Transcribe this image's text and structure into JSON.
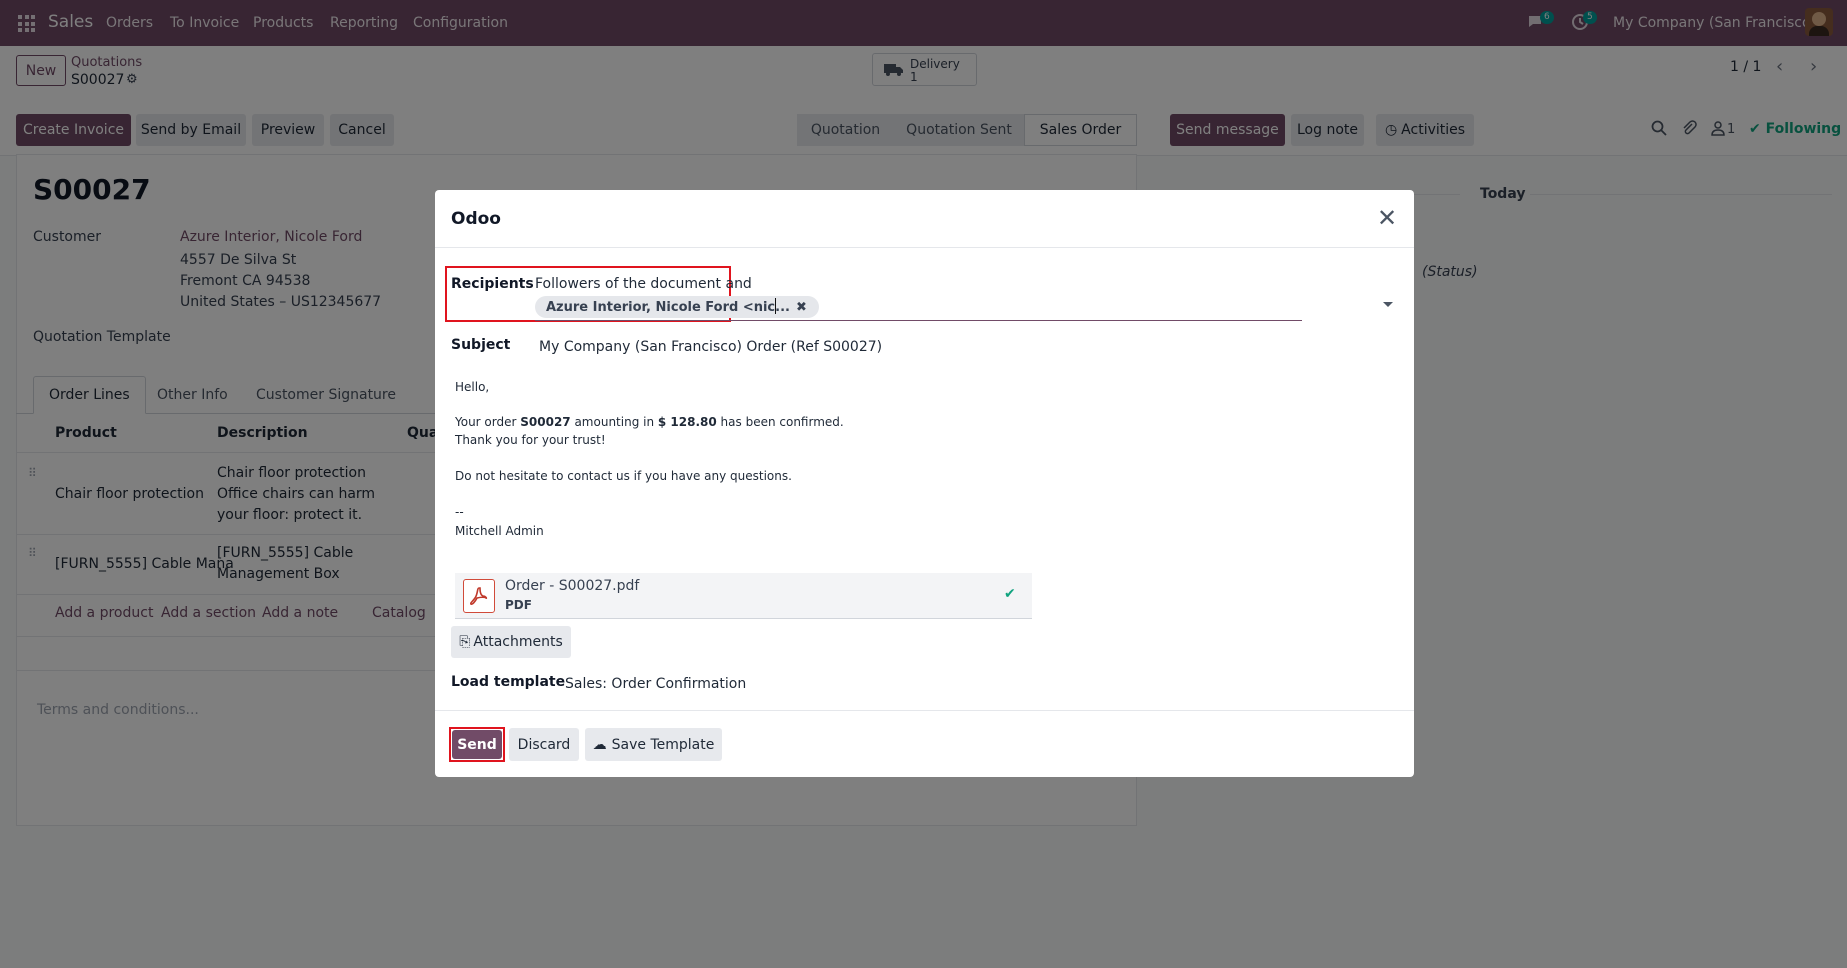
{
  "navbar": {
    "app": "Sales",
    "menu": [
      "Orders",
      "To Invoice",
      "Products",
      "Reporting",
      "Configuration"
    ],
    "messages_badge": "6",
    "activities_badge": "5",
    "company": "My Company (San Francisco)"
  },
  "control_panel": {
    "new_label": "New",
    "breadcrumb_parent": "Quotations",
    "breadcrumb_current": "S00027",
    "delivery_label": "Delivery",
    "delivery_count": "1",
    "pager": "1 / 1"
  },
  "actions": {
    "create_invoice": "Create Invoice",
    "send_by_email": "Send by Email",
    "preview": "Preview",
    "cancel": "Cancel"
  },
  "statusbar": [
    "Quotation",
    "Quotation Sent",
    "Sales Order"
  ],
  "chatter": {
    "send_message": "Send message",
    "log_note": "Log note",
    "activities": "Activities",
    "followers_count": "1",
    "following": "Following",
    "today": "Today",
    "status": "(Status)"
  },
  "form": {
    "name": "S00027",
    "customer_label": "Customer",
    "customer_name": "Azure Interior, Nicole Ford",
    "address": [
      "4557 De Silva St",
      "Fremont CA 94538",
      "United States – US12345677"
    ],
    "template_label": "Quotation Template",
    "tabs": [
      "Order Lines",
      "Other Info",
      "Customer Signature"
    ],
    "columns": [
      "Product",
      "Description",
      "Qua"
    ],
    "lines": [
      {
        "product": "Chair floor protection",
        "description": [
          "Chair floor protection",
          "Office chairs can harm",
          "your floor: protect it."
        ]
      },
      {
        "product": "[FURN_5555] Cable Mana",
        "description": [
          "[FURN_5555] Cable",
          "Management Box"
        ]
      }
    ],
    "add_links": [
      "Add a product",
      "Add a section",
      "Add a note",
      "Catalog"
    ],
    "terms_placeholder": "Terms and conditions..."
  },
  "modal": {
    "title": "Odoo",
    "recipients_label": "Recipients",
    "recipients_text": "Followers of the document and",
    "recipient_tag": "Azure Interior, Nicole Ford <nic...",
    "subject_label": "Subject",
    "subject_value": "My Company (San Francisco) Order (Ref S00027)",
    "body": {
      "greeting": "Hello,",
      "order_prefix": "Your order ",
      "order_ref": "S00027",
      "amount_prefix": " amounting in ",
      "amount": "$ 128.80",
      "amount_suffix": " has been confirmed.",
      "thanks": "Thank you for your trust!",
      "contact": "Do not hesitate to contact us if you have any questions.",
      "sig_sep": "--",
      "signature": "Mitchell Admin"
    },
    "attachment_name": "Order - S00027.pdf",
    "attachment_type": "PDF",
    "attachments_button": "Attachments",
    "load_template_label": "Load template",
    "load_template_value": "Sales: Order Confirmation",
    "send": "Send",
    "discard": "Discard",
    "save_template": "Save Template"
  },
  "colors": {
    "brand": "#714b67",
    "highlight": "#e0141e",
    "success": "#10a37f"
  }
}
